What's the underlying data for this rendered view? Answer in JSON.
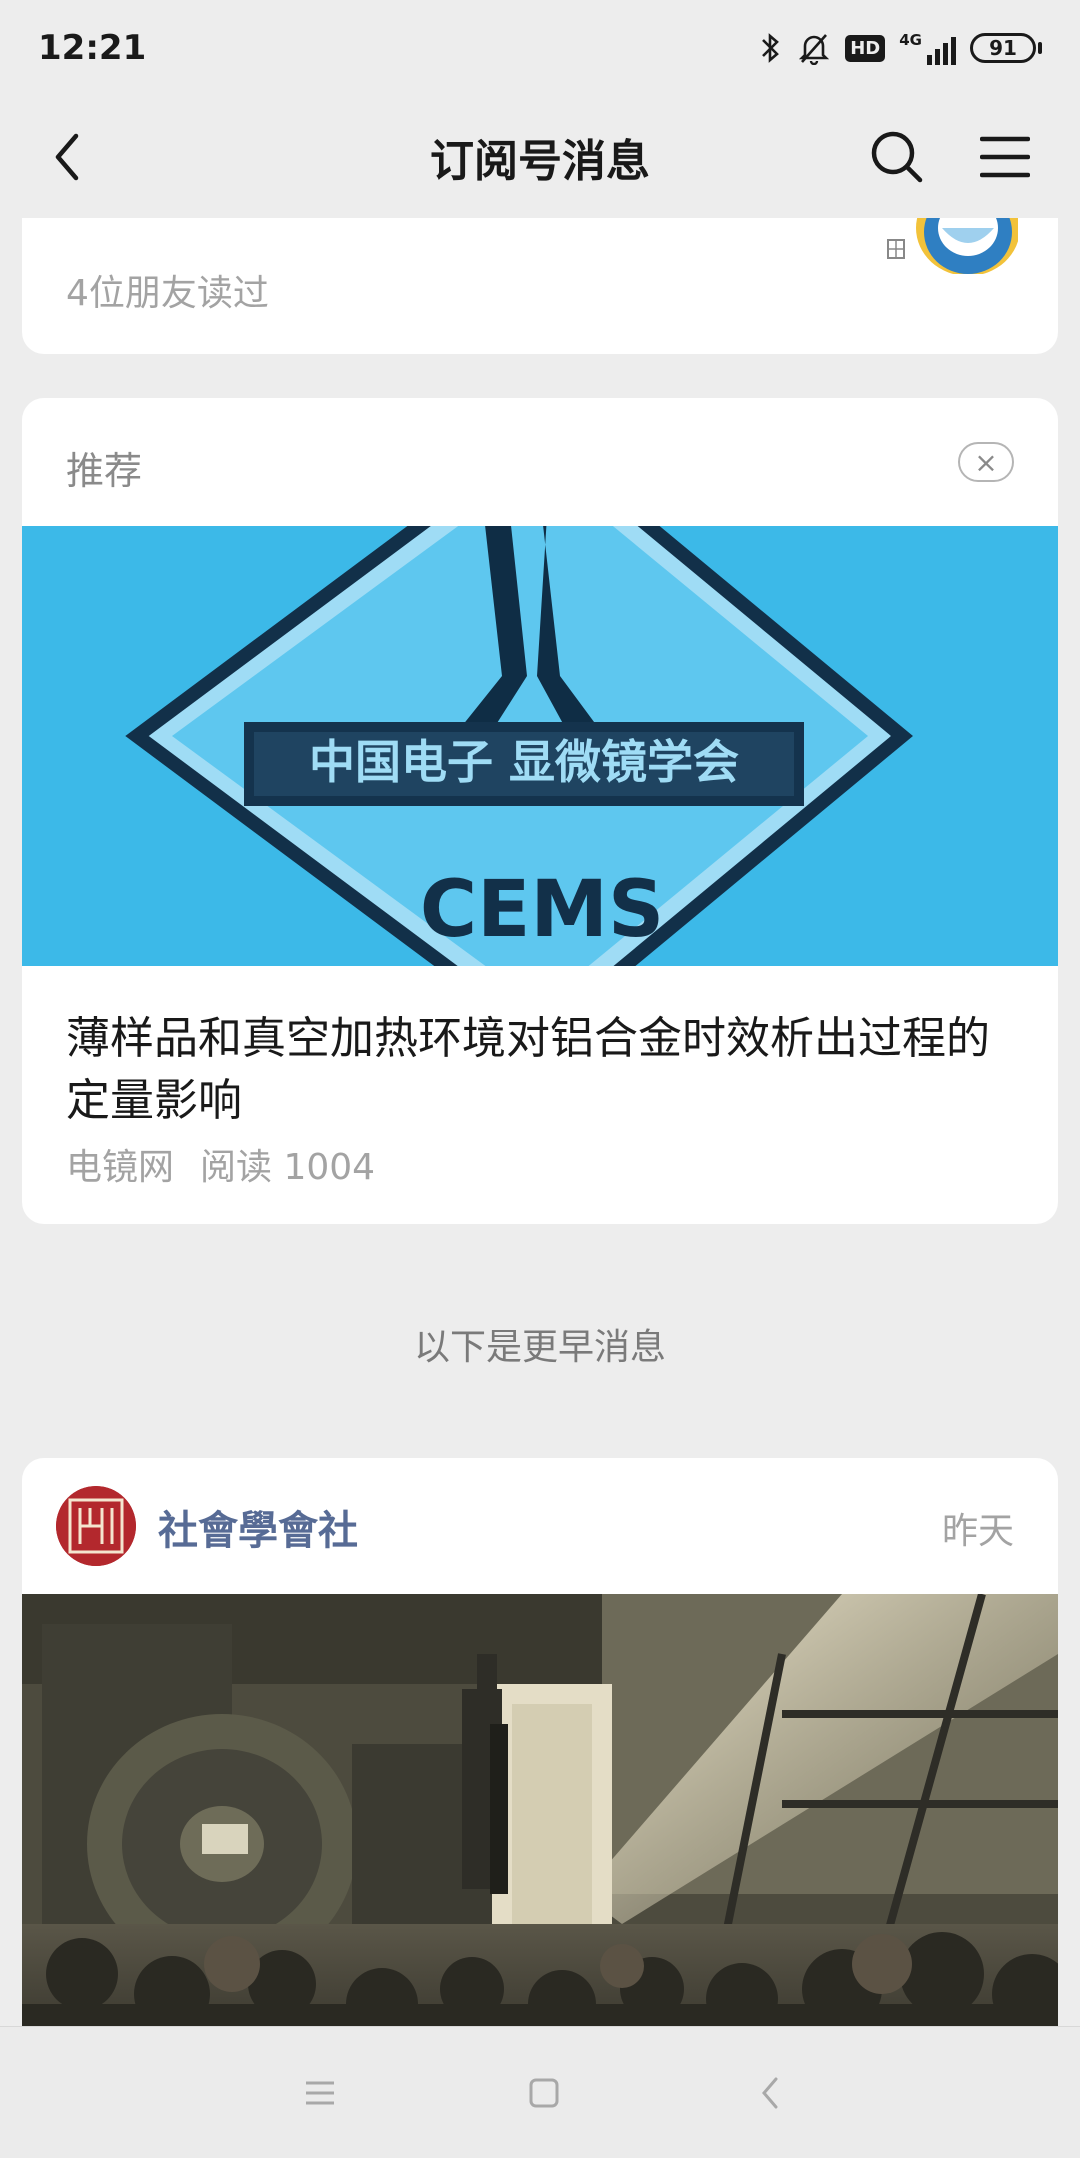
{
  "status_bar": {
    "time": "12:21",
    "hd": "HD",
    "network": "4G",
    "battery": "91",
    "icons": [
      "bluetooth-icon",
      "mute-bell-icon",
      "hd-icon",
      "signal-icon",
      "battery-icon"
    ]
  },
  "nav": {
    "title": "订阅号消息",
    "icons": [
      "back-arrow-icon",
      "search-icon",
      "menu-icon"
    ]
  },
  "top_card": {
    "friends_read": "4位朋友读过"
  },
  "recommend": {
    "header": "推荐",
    "close": "×",
    "title": "薄样品和真空加热环境对铝合金时效析出过程的定量影响",
    "source": "电镜网",
    "read_label": "阅读 1004",
    "logo_text": "CEMS",
    "logo_band_text": "中国电子 显微镜学会",
    "image_bg": "#3bb8e6"
  },
  "divider": {
    "text": "以下是更早消息"
  },
  "feed": {
    "account_name": "社會學會社",
    "time": "昨天",
    "avatar_color": "#b3282d"
  },
  "system_nav": {
    "icons": [
      "recent-apps-icon",
      "home-icon",
      "back-icon"
    ]
  },
  "colors": {
    "background": "#ededed",
    "card": "#ffffff",
    "link_blue": "#576b95",
    "muted": "#a3a3a3"
  }
}
